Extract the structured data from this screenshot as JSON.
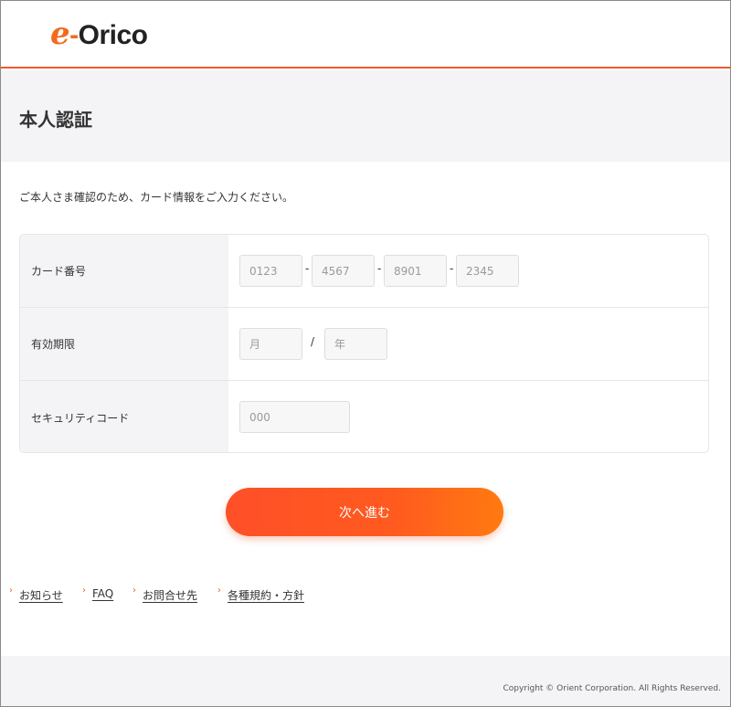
{
  "header": {
    "logo": {
      "e": "e",
      "dash": "-",
      "rest": "Orico"
    }
  },
  "page": {
    "title": "本人認証",
    "intro": "ご本人さま確認のため、カード情報をご入力ください。"
  },
  "form": {
    "card_number": {
      "label": "カード番号",
      "placeholders": [
        "0123",
        "4567",
        "8901",
        "2345"
      ],
      "separator": "-"
    },
    "expiry": {
      "label": "有効期限",
      "month_placeholder": "月",
      "year_placeholder": "年",
      "separator": "/"
    },
    "security_code": {
      "label": "セキュリティコード",
      "placeholder": "000"
    }
  },
  "actions": {
    "next_label": "次へ進む"
  },
  "footer": {
    "links": [
      "お知らせ",
      "FAQ",
      "お問合せ先",
      "各種規約・方針"
    ],
    "copyright": "Copyright © Orient Corporation. All Rights Reserved."
  },
  "colors": {
    "brand_orange": "#f05a28",
    "button_gradient_start": "#ff4f28",
    "button_gradient_end": "#ff7a10"
  }
}
